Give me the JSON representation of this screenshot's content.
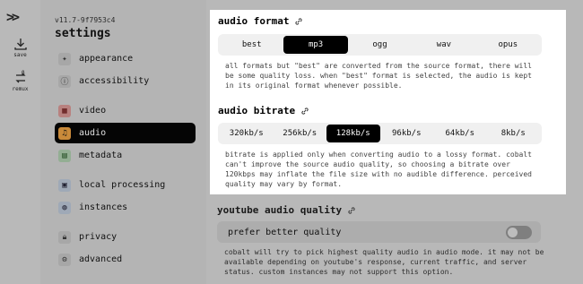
{
  "rail": {
    "logo": ">>",
    "save_label": "save",
    "remux_label": "remux",
    "remux_badge": "β"
  },
  "sidebar": {
    "version": "v11.7-9f7953c4",
    "title": "settings",
    "items": [
      {
        "label": "appearance",
        "icon": "sparkle-icon"
      },
      {
        "label": "accessibility",
        "icon": "accessibility-icon"
      },
      {
        "label": "video",
        "icon": "film-icon"
      },
      {
        "label": "audio",
        "icon": "music-icon",
        "active": true
      },
      {
        "label": "metadata",
        "icon": "file-icon"
      },
      {
        "label": "local processing",
        "icon": "chip-icon"
      },
      {
        "label": "instances",
        "icon": "globe-icon"
      },
      {
        "label": "privacy",
        "icon": "lock-icon"
      },
      {
        "label": "advanced",
        "icon": "sliders-icon"
      }
    ]
  },
  "audio_format": {
    "title": "audio format",
    "options": [
      "best",
      "mp3",
      "ogg",
      "wav",
      "opus"
    ],
    "selected": "mp3",
    "description": "all formats but \"best\" are converted from the source format, there will be some quality loss. when \"best\" format is selected, the audio is kept in its original format whenever possible."
  },
  "audio_bitrate": {
    "title": "audio bitrate",
    "options": [
      "320kb/s",
      "256kb/s",
      "128kb/s",
      "96kb/s",
      "64kb/s",
      "8kb/s"
    ],
    "selected": "128kb/s",
    "description": "bitrate is applied only when converting audio to a lossy format. cobalt can't improve the source audio quality, so choosing a bitrate over 120kbps may inflate the file size with no audible difference. perceived quality may vary by format."
  },
  "youtube_audio_quality": {
    "title": "youtube audio quality",
    "toggle_label": "prefer better quality",
    "toggle_on": false,
    "description": "cobalt will try to pick highest quality audio in audio mode. it may not be available depending on youtube's response, current traffic, and server status. custom instances may not support this option."
  },
  "colors": {
    "accent_active_icon": "#c98a3a",
    "selected_bg": "#000000",
    "panel_bg": "#ffffff"
  }
}
